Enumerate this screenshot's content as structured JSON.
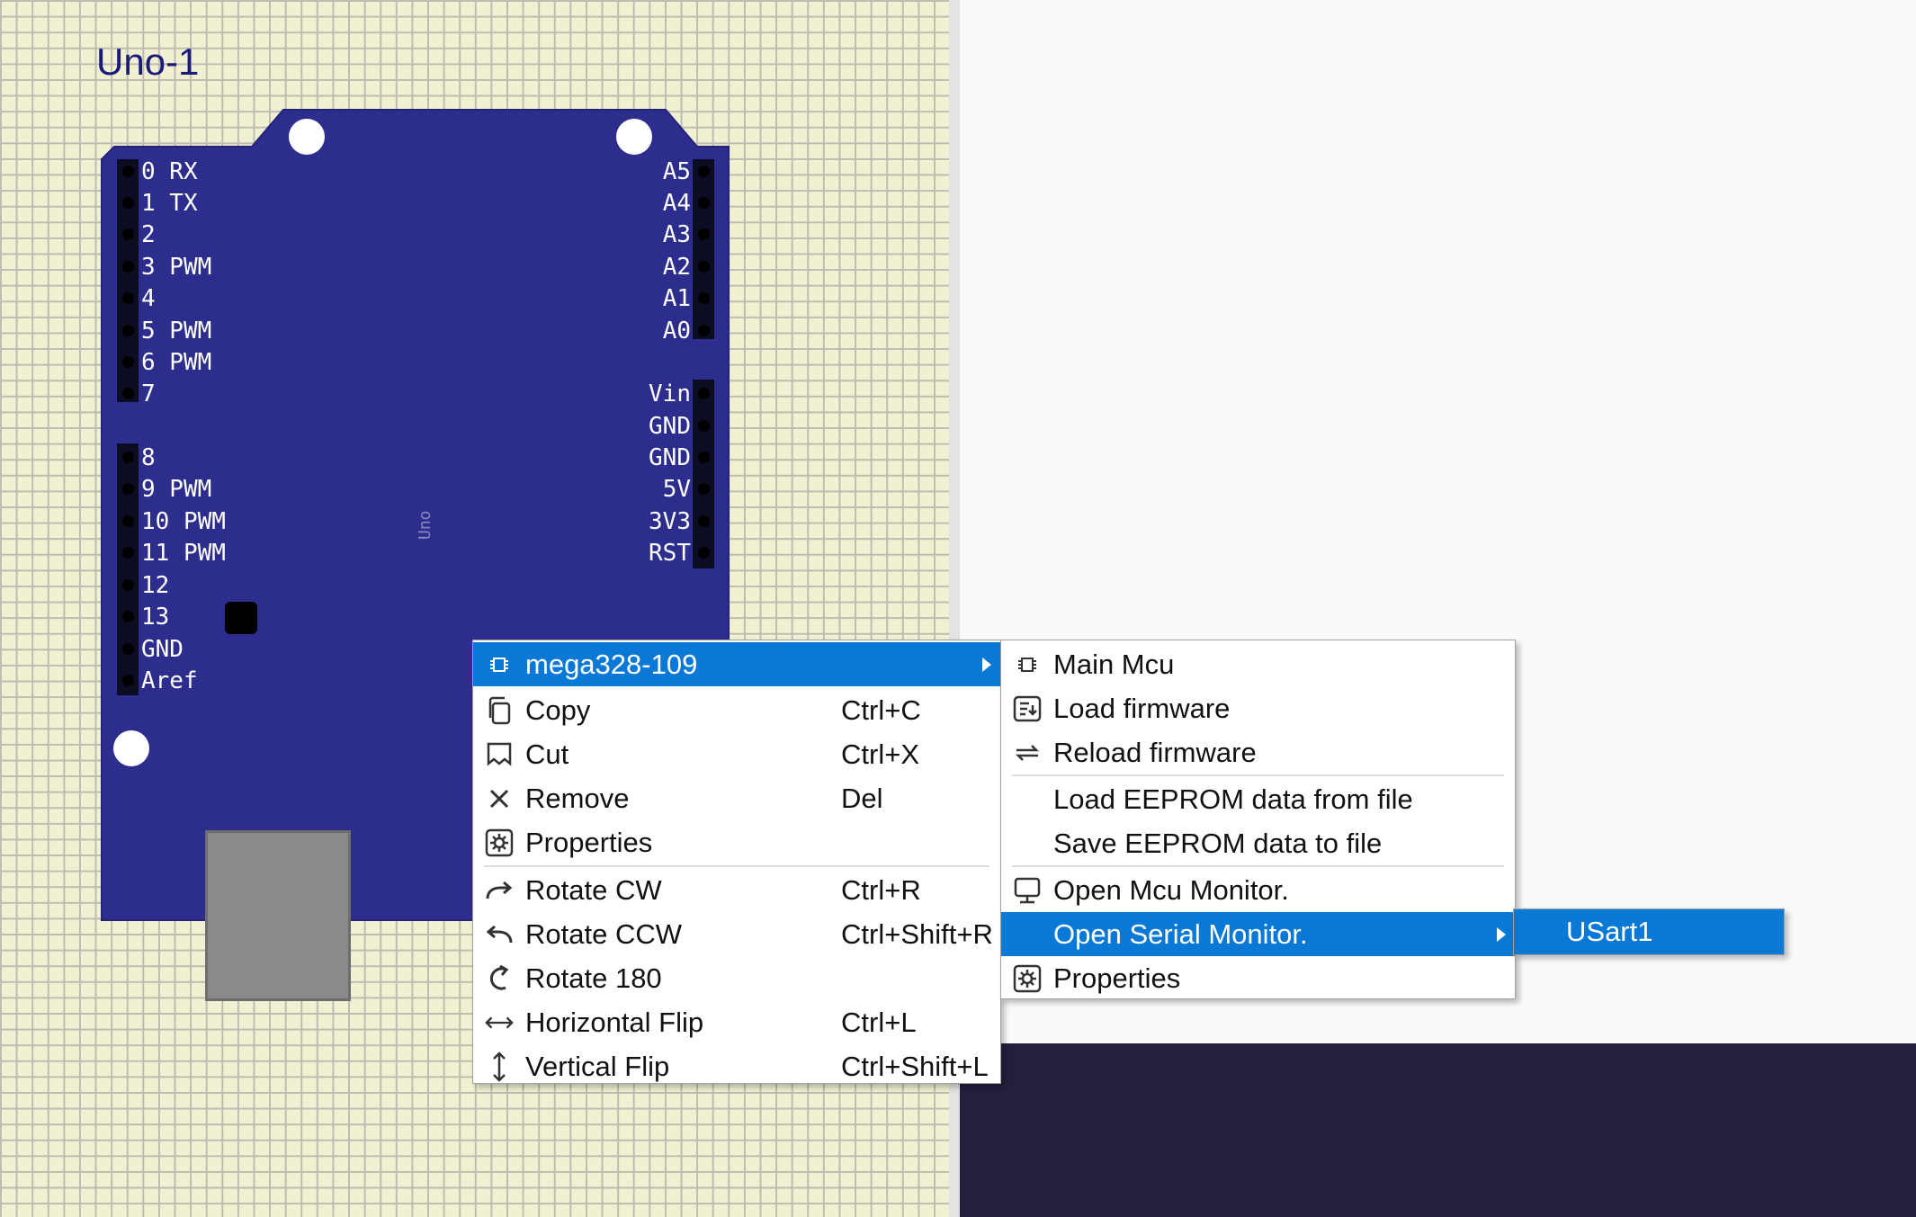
{
  "component": {
    "title": "Uno-1",
    "board_label": "Uno"
  },
  "pins_left": [
    {
      "label": "0 RX"
    },
    {
      "label": "1 TX"
    },
    {
      "label": "2"
    },
    {
      "label": "3 PWM"
    },
    {
      "label": "4"
    },
    {
      "label": "5 PWM"
    },
    {
      "label": "6 PWM"
    },
    {
      "label": "7"
    },
    {
      "label": "8"
    },
    {
      "label": "9 PWM"
    },
    {
      "label": "10 PWM"
    },
    {
      "label": "11 PWM"
    },
    {
      "label": "12"
    },
    {
      "label": "13"
    },
    {
      "label": "GND"
    },
    {
      "label": "Aref"
    }
  ],
  "pins_right": [
    {
      "label": "A5"
    },
    {
      "label": "A4"
    },
    {
      "label": "A3"
    },
    {
      "label": "A2"
    },
    {
      "label": "A1"
    },
    {
      "label": "A0"
    },
    {
      "label": "Vin"
    },
    {
      "label": "GND"
    },
    {
      "label": "GND"
    },
    {
      "label": "5V"
    },
    {
      "label": "3V3"
    },
    {
      "label": "RST"
    }
  ],
  "context_menu": {
    "items": [
      {
        "label": "mega328-109",
        "shortcut": "",
        "icon": "chip-icon"
      },
      {
        "label": "Copy",
        "shortcut": "Ctrl+C",
        "icon": "copy-icon"
      },
      {
        "label": "Cut",
        "shortcut": "Ctrl+X",
        "icon": "cut-icon"
      },
      {
        "label": "Remove",
        "shortcut": "Del",
        "icon": "remove-icon"
      },
      {
        "label": "Properties",
        "shortcut": "",
        "icon": "gear-icon"
      },
      {
        "label": "Rotate CW",
        "shortcut": "Ctrl+R",
        "icon": "rotate-cw-icon"
      },
      {
        "label": "Rotate CCW",
        "shortcut": "Ctrl+Shift+R",
        "icon": "rotate-ccw-icon"
      },
      {
        "label": "Rotate 180",
        "shortcut": "",
        "icon": "rotate-180-icon"
      },
      {
        "label": "Horizontal Flip",
        "shortcut": "Ctrl+L",
        "icon": "horizontal-flip-icon"
      },
      {
        "label": "Vertical Flip",
        "shortcut": "Ctrl+Shift+L",
        "icon": "vertical-flip-icon"
      }
    ]
  },
  "mcu_submenu": {
    "items": [
      {
        "label": "Main Mcu",
        "icon": "chip-icon"
      },
      {
        "label": "Load firmware",
        "icon": "load-firmware-icon"
      },
      {
        "label": "Reload firmware",
        "icon": "reload-icon"
      },
      {
        "label": "Load EEPROM data from file",
        "icon": ""
      },
      {
        "label": "Save EEPROM data to file",
        "icon": ""
      },
      {
        "label": "Open Mcu Monitor.",
        "icon": "monitor-icon"
      },
      {
        "label": "Open Serial Monitor.",
        "icon": ""
      },
      {
        "label": "Properties",
        "icon": "gear-icon"
      }
    ]
  },
  "serial_submenu": {
    "items": [
      {
        "label": "USart1"
      }
    ]
  },
  "colors": {
    "board": "#2d2d8e",
    "highlight": "#0a79d6",
    "grid_background": "#f1f0d2",
    "dark_panel": "#231f3d"
  }
}
